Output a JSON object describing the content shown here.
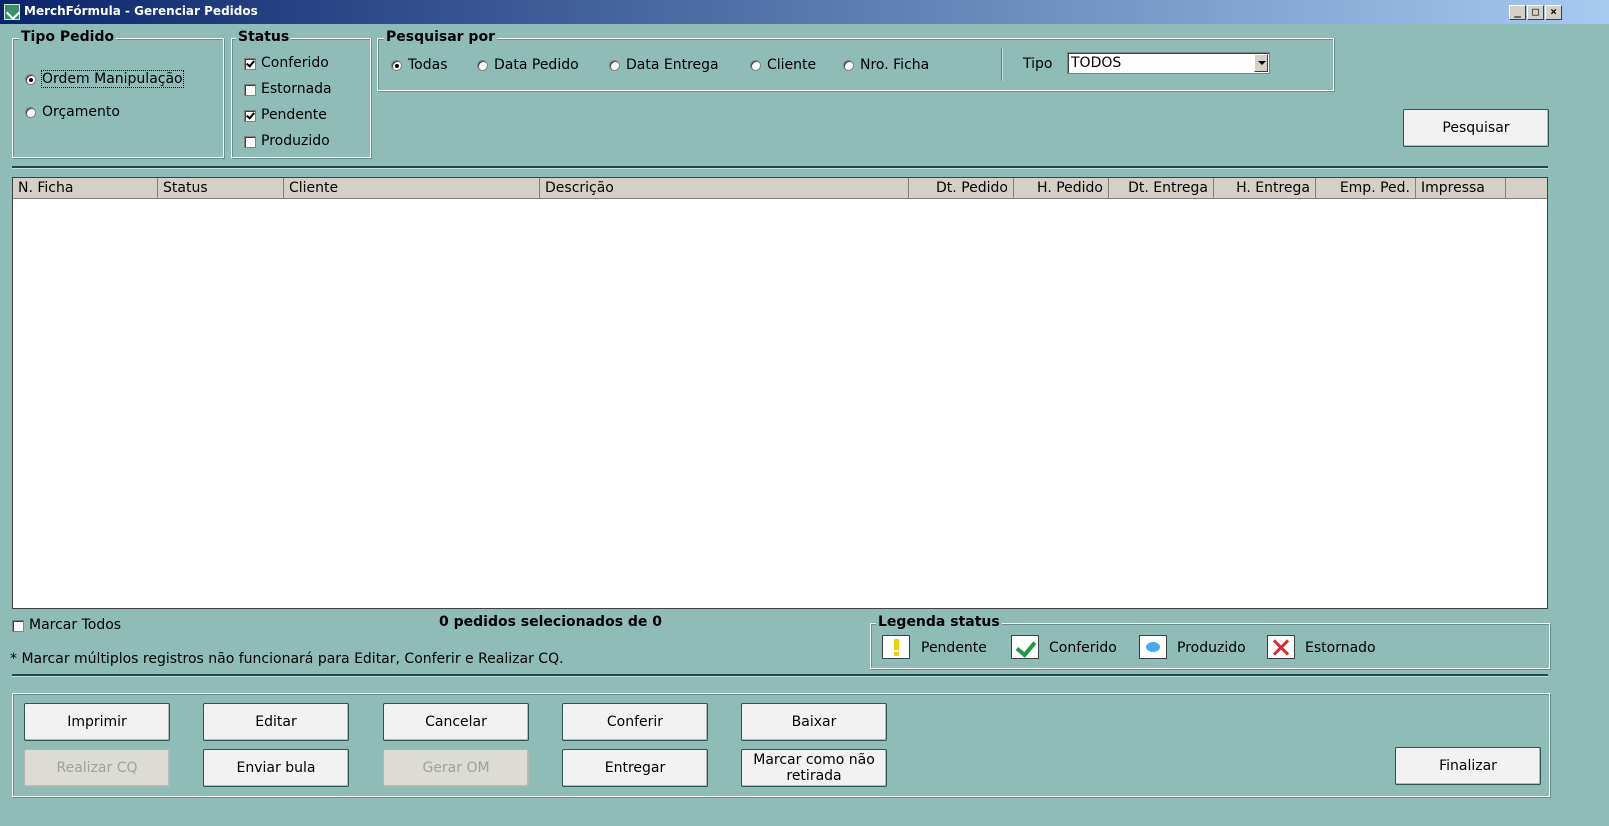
{
  "window": {
    "title": "MerchFórmula - Gerenciar Pedidos"
  },
  "tipo_pedido": {
    "legend": "Tipo Pedido",
    "options": [
      {
        "label": "Ordem Manipulação",
        "selected": true
      },
      {
        "label": "Orçamento",
        "selected": false
      }
    ]
  },
  "status": {
    "legend": "Status",
    "options": [
      {
        "label": "Conferido",
        "checked": true
      },
      {
        "label": "Estornada",
        "checked": false
      },
      {
        "label": "Pendente",
        "checked": true
      },
      {
        "label": "Produzido",
        "checked": false
      }
    ]
  },
  "pesquisar_por": {
    "legend": "Pesquisar por",
    "options": [
      {
        "label": "Todas",
        "selected": true
      },
      {
        "label": "Data Pedido",
        "selected": false
      },
      {
        "label": "Data Entrega",
        "selected": false
      },
      {
        "label": "Cliente",
        "selected": false
      },
      {
        "label": "Nro. Ficha",
        "selected": false
      }
    ],
    "tipo_label": "Tipo",
    "tipo_value": "TODOS"
  },
  "pesquisar_button": "Pesquisar",
  "grid": {
    "columns": [
      "N. Ficha",
      "Status",
      "Cliente",
      "Descrição",
      "Dt. Pedido",
      "H. Pedido",
      "Dt. Entrega",
      "H. Entrega",
      "Emp. Ped.",
      "Impressa"
    ]
  },
  "marcar_todos": "Marcar Todos",
  "selection_count": "0 pedidos selecionados de 0",
  "note": "* Marcar múltiplos registros não funcionará para Editar, Conferir e Realizar CQ.",
  "legenda": {
    "legend": "Legenda status",
    "items": [
      "Pendente",
      "Conferido",
      "Produzido",
      "Estornado"
    ]
  },
  "buttons": {
    "imprimir": "Imprimir",
    "editar": "Editar",
    "cancelar": "Cancelar",
    "conferir": "Conferir",
    "baixar": "Baixar",
    "realizar_cq": "Realizar CQ",
    "enviar_bula": "Enviar bula",
    "gerar_om": "Gerar OM",
    "entregar": "Entregar",
    "marcar_nao_retirada_1": "Marcar como não",
    "marcar_nao_retirada_2": "retirada",
    "finalizar": "Finalizar"
  },
  "colors": {
    "background": "#8fbcb7",
    "titlebar_start": "#0a246a",
    "titlebar_end": "#a6caf0"
  },
  "icons": [
    "app-icon",
    "minimize-icon",
    "maximize-icon",
    "close-icon",
    "exclamation-icon",
    "checkmark-icon",
    "blue-oval-icon",
    "red-x-icon"
  ]
}
